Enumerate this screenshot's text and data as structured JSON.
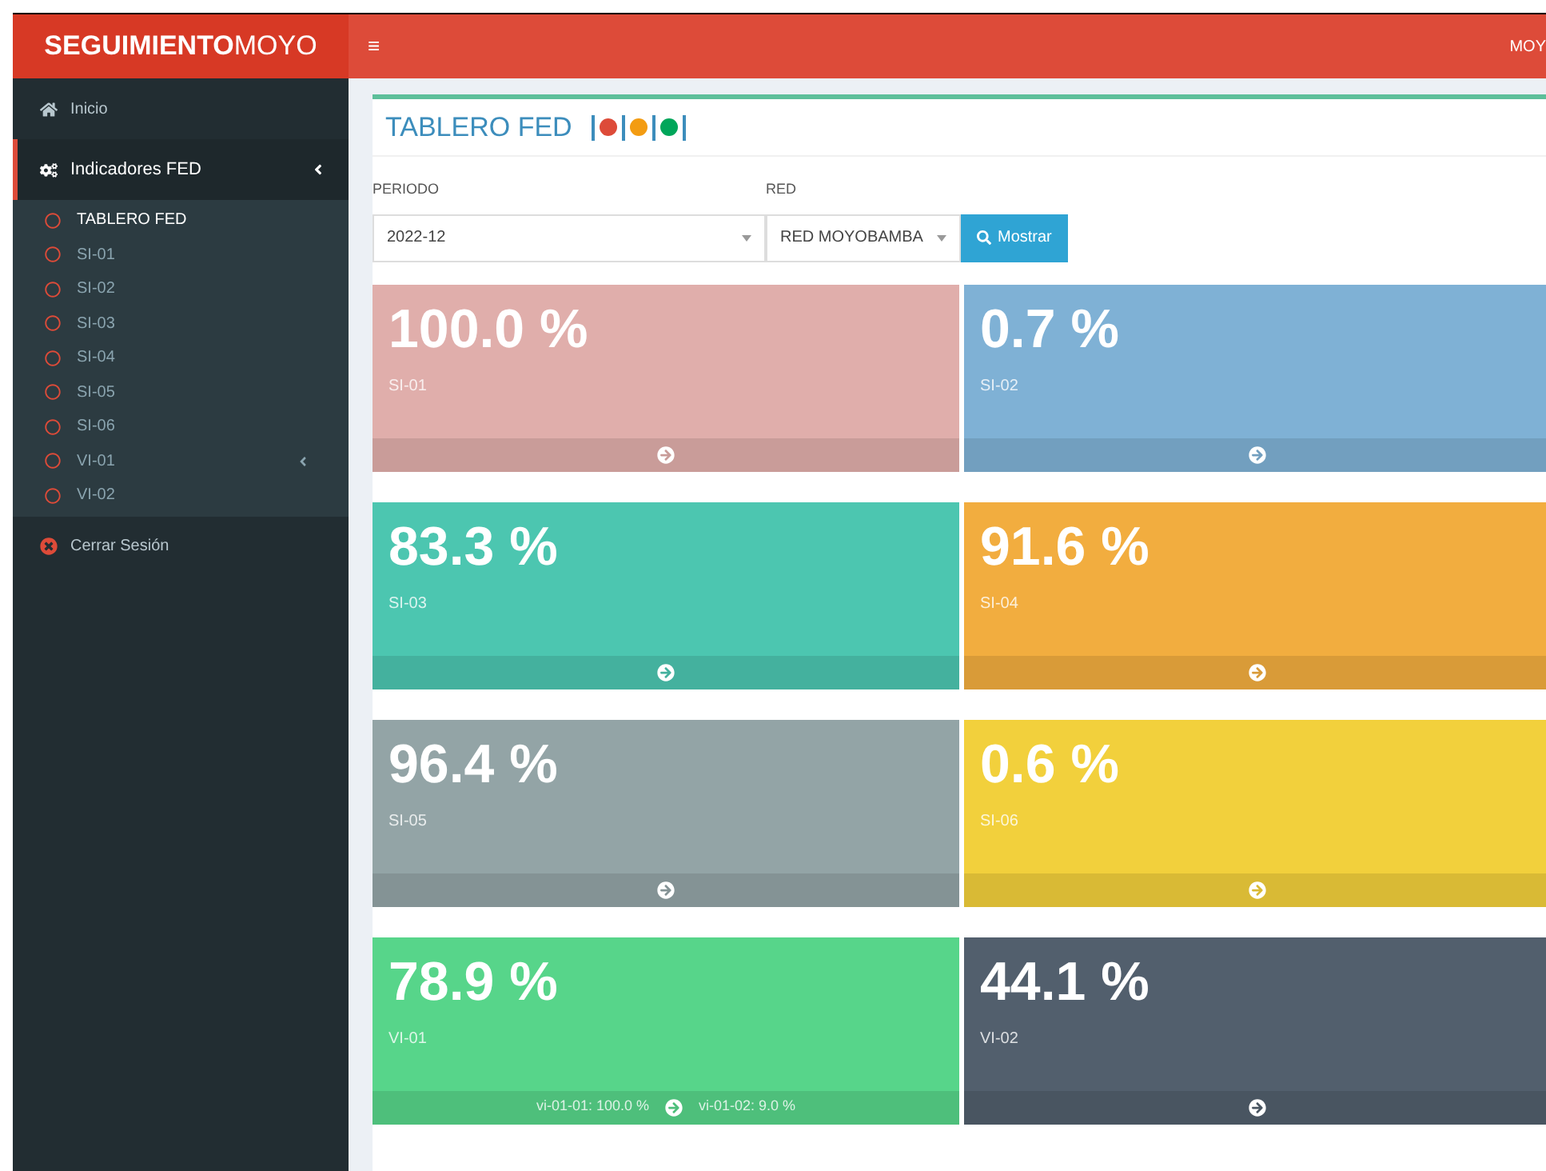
{
  "header": {
    "logo_bold": "SEGUIMIENTO",
    "logo_light": "MOYO",
    "menu_glyph": "≡",
    "user": "MOY"
  },
  "sidebar": {
    "items": [
      {
        "kind": "link",
        "label": "Inicio"
      },
      {
        "kind": "group",
        "label": "Indicadores FED",
        "expanded": true,
        "children": [
          {
            "label": "TABLERO FED",
            "selected": true,
            "has_children": false
          },
          {
            "label": "SI-01",
            "selected": false,
            "has_children": false
          },
          {
            "label": "SI-02",
            "selected": false,
            "has_children": false
          },
          {
            "label": "SI-03",
            "selected": false,
            "has_children": false
          },
          {
            "label": "SI-04",
            "selected": false,
            "has_children": false
          },
          {
            "label": "SI-05",
            "selected": false,
            "has_children": false
          },
          {
            "label": "SI-06",
            "selected": false,
            "has_children": false
          },
          {
            "label": "VI-01",
            "selected": false,
            "has_children": true
          },
          {
            "label": "VI-02",
            "selected": false,
            "has_children": false
          }
        ]
      },
      {
        "kind": "logout",
        "label": "Cerrar Sesión"
      }
    ]
  },
  "panel": {
    "title": "TABLERO FED",
    "legend": [
      {
        "color": "#dd4b39"
      },
      {
        "color": "#f39c12"
      },
      {
        "color": "#00a65a"
      }
    ],
    "filters": [
      {
        "label": "PERIODO",
        "value": "2022-12"
      },
      {
        "label": "RED",
        "value": "RED MOYOBAMBA"
      }
    ],
    "button": "Mostrar"
  },
  "cards": [
    {
      "value": "100.0 %",
      "label": "SI-01",
      "color": "#e0aeab"
    },
    {
      "value": "0.7 %",
      "label": "SI-02",
      "color": "#7fb1d5"
    },
    {
      "value": "83.3 %",
      "label": "SI-03",
      "color": "#4cc6b0"
    },
    {
      "value": "91.6 %",
      "label": "SI-04",
      "color": "#f2ad3f"
    },
    {
      "value": "96.4 %",
      "label": "SI-05",
      "color": "#93a4a6"
    },
    {
      "value": "0.6 %",
      "label": "SI-06",
      "color": "#f2d03c"
    },
    {
      "value": "78.9 %",
      "label": "VI-01",
      "color": "#57d58a",
      "footer": {
        "before": "vi-01-01: 100.0 %",
        "after": "vi-01-02: 9.0 %"
      }
    },
    {
      "value": "44.1 %",
      "label": "VI-02",
      "color": "#525f6d"
    }
  ]
}
